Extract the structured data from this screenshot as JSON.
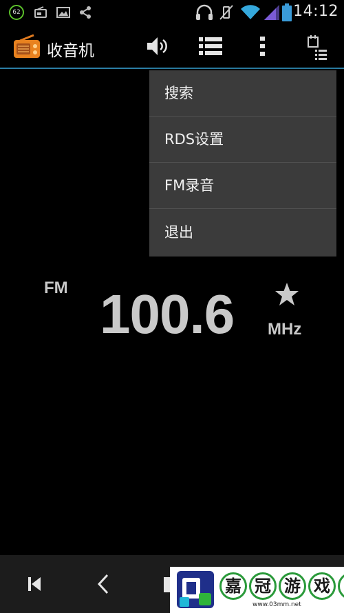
{
  "status_bar": {
    "battery_badge": "62",
    "time": "14:12",
    "icons": [
      "battery-level-badge",
      "radio-notification-icon",
      "image-notification-icon",
      "share-icon",
      "headset-icon",
      "vibrate-off-icon",
      "wifi-icon",
      "signal-icon",
      "battery-icon"
    ]
  },
  "action_bar": {
    "title": "收音机",
    "icons": [
      "radio-app-icon",
      "speaker-icon",
      "list-icon",
      "overflow-menu-icon",
      "schedule-list-icon"
    ]
  },
  "menu": {
    "items": [
      {
        "label": "搜索"
      },
      {
        "label": "RDS设置"
      },
      {
        "label": "FM录音"
      },
      {
        "label": "退出"
      }
    ]
  },
  "tuner": {
    "band": "FM",
    "frequency": "100.6",
    "unit": "MHz",
    "favorite_icon": "star-icon"
  },
  "nav_bar": {
    "icons": [
      "skip-previous-icon",
      "back-icon",
      "stop-icon"
    ]
  },
  "watermark": {
    "chars": [
      "嘉",
      "冠",
      "游",
      "戏",
      "网"
    ],
    "url": "www.03mm.net"
  },
  "colors": {
    "background": "#000000",
    "accent_line": "#2b7fa6",
    "menu_bg": "#3b3b3b",
    "frequency_text": "#c9c9c9",
    "status_green": "#5bbf2a",
    "wifi_blue": "#35a8dc",
    "signal_purple": "#7b5bd6",
    "battery_blue": "#3a9bd8"
  }
}
